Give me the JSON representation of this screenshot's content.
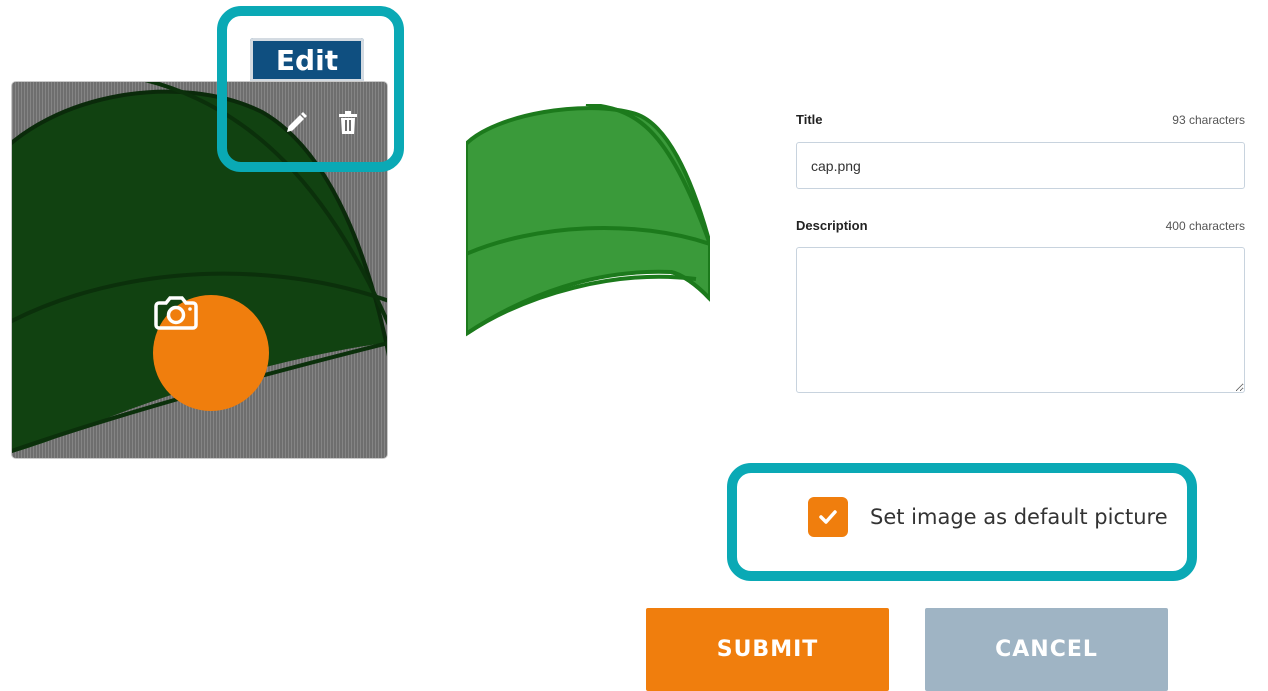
{
  "callout": {
    "edit_label": "Edit"
  },
  "image_tile": {
    "actions": [
      "pencil-icon",
      "trash-icon"
    ],
    "upload_icon": "camera-icon",
    "upload_color": "#f07e0d"
  },
  "form": {
    "title": {
      "label": "Title",
      "count": "93 characters",
      "value": "cap.png"
    },
    "description": {
      "label": "Description",
      "count": "400 characters",
      "value": ""
    },
    "default_picture": {
      "label": "Set image as default picture",
      "checked": true
    }
  },
  "buttons": {
    "submit": "SUBMIT",
    "cancel": "CANCEL"
  },
  "colors": {
    "accent": "#f07e0d",
    "highlight": "#0aa9b5",
    "cancel": "#9fb4c4",
    "edit_tag": "#0f4f80"
  }
}
